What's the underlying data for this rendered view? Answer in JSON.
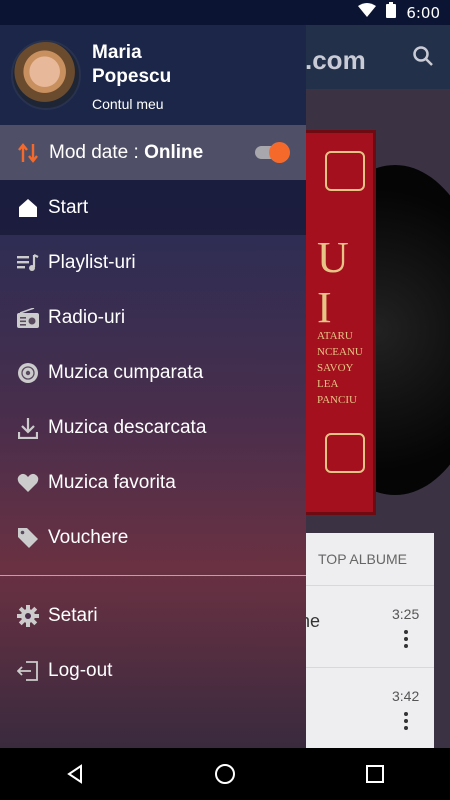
{
  "status_bar": {
    "time": "6:00"
  },
  "background_app": {
    "logo_text": ".com",
    "tab_label": "TOP ALBUME",
    "tracks": [
      {
        "duration": "3:25",
        "title_fragment": "ne"
      },
      {
        "duration": "3:42",
        "title_fragment": ""
      }
    ]
  },
  "drawer": {
    "profile": {
      "name": "Maria Popescu",
      "account_link": "Contul meu"
    },
    "data_mode": {
      "label": "Mod date : ",
      "value": "Online",
      "enabled": true
    },
    "menu": [
      {
        "label": "Start",
        "icon": "home-icon",
        "active": true
      },
      {
        "label": "Playlist-uri",
        "icon": "playlist-icon"
      },
      {
        "label": "Radio-uri",
        "icon": "radio-icon"
      },
      {
        "label": "Muzica cumparata",
        "icon": "disc-icon"
      },
      {
        "label": "Muzica descarcata",
        "icon": "download-icon"
      },
      {
        "label": "Muzica favorita",
        "icon": "heart-icon"
      },
      {
        "label": "Vouchere",
        "icon": "tag-icon"
      }
    ],
    "secondary_menu": [
      {
        "label": "Setari",
        "icon": "gear-icon"
      },
      {
        "label": "Log-out",
        "icon": "logout-icon"
      }
    ]
  },
  "colors": {
    "accent": "#f56a2b",
    "drawer_header": "#1b2648",
    "mode_bar": "#4f5067"
  }
}
